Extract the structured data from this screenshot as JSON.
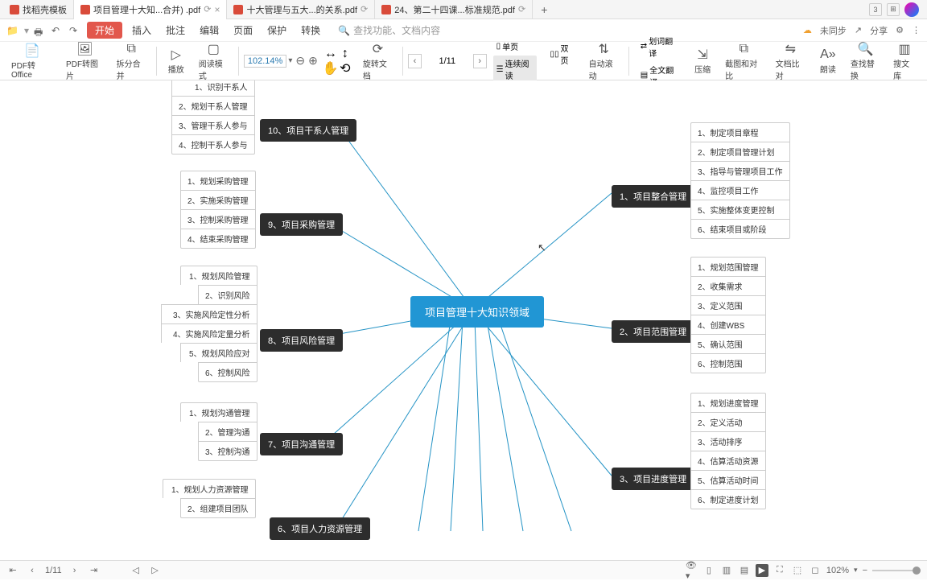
{
  "tabs": [
    {
      "label": "找稻壳模板"
    },
    {
      "label": "项目管理十大知...合并) .pdf",
      "active": true
    },
    {
      "label": "十大管理与五大...的关系.pdf"
    },
    {
      "label": "24、第二十四课...标准规范.pdf"
    }
  ],
  "topbar": {
    "start": "开始",
    "menu": [
      "插入",
      "批注",
      "编辑",
      "页面",
      "保护",
      "转换"
    ],
    "search_placeholder": "查找功能、文档内容",
    "unsync": "未同步",
    "share": "分享"
  },
  "ribbon": {
    "pdf_office": "PDF转Office",
    "pdf_img": "PDF转图片",
    "split_merge": "拆分合并",
    "play": "播放",
    "read_mode": "阅读模式",
    "zoom": "102.14%",
    "rotate": "旋转文档",
    "page_nav": "1/11",
    "single": "单页",
    "double": "双页",
    "cont": "连续阅读",
    "auto_scroll": "自动滚动",
    "word_trans": "划词翻译",
    "full_trans": "全文翻译",
    "compress": "压缩",
    "compare": "截图和对比",
    "doc_compare": "文档比对",
    "read_aloud": "朗读",
    "find_replace": "查找替换",
    "search_lib": "搜文库"
  },
  "mindmap": {
    "center": "项目管理十大知识领域",
    "branches": {
      "b1": {
        "title": "1、项目整合管理",
        "leaves": [
          "1、制定项目章程",
          "2、制定项目管理计划",
          "3、指导与管理项目工作",
          "4、监控项目工作",
          "5、实施整体变更控制",
          "6、结束项目或阶段"
        ]
      },
      "b2": {
        "title": "2、项目范围管理",
        "leaves": [
          "1、规划范围管理",
          "2、收集需求",
          "3、定义范围",
          "4、创建WBS",
          "5、确认范围",
          "6、控制范围"
        ]
      },
      "b3": {
        "title": "3、项目进度管理",
        "leaves": [
          "1、规划进度管理",
          "2、定义活动",
          "3、活动排序",
          "4、估算活动资源",
          "5、估算活动时间",
          "6、制定进度计划"
        ]
      },
      "b6": {
        "title": "6、项目人力资源管理",
        "leaves": [
          "1、规划人力资源管理",
          "2、组建项目团队"
        ]
      },
      "b7": {
        "title": "7、项目沟通管理",
        "leaves": [
          "1、规划沟通管理",
          "2、管理沟通",
          "3、控制沟通"
        ]
      },
      "b8": {
        "title": "8、项目风险管理",
        "leaves": [
          "1、规划风险管理",
          "2、识别风险",
          "3、实施风险定性分析",
          "4、实施风险定量分析",
          "5、规划风险应对",
          "6、控制风险"
        ]
      },
      "b9": {
        "title": "9、项目采购管理",
        "leaves": [
          "1、规划采购管理",
          "2、实施采购管理",
          "3、控制采购管理",
          "4、结束采购管理"
        ]
      },
      "b10": {
        "title": "10、项目干系人管理",
        "leaves": [
          "1、识别干系人",
          "2、规划干系人管理",
          "3、管理干系人参与",
          "4、控制干系人参与"
        ]
      }
    }
  },
  "statusbar": {
    "page": "1/11",
    "zoom": "102%"
  }
}
